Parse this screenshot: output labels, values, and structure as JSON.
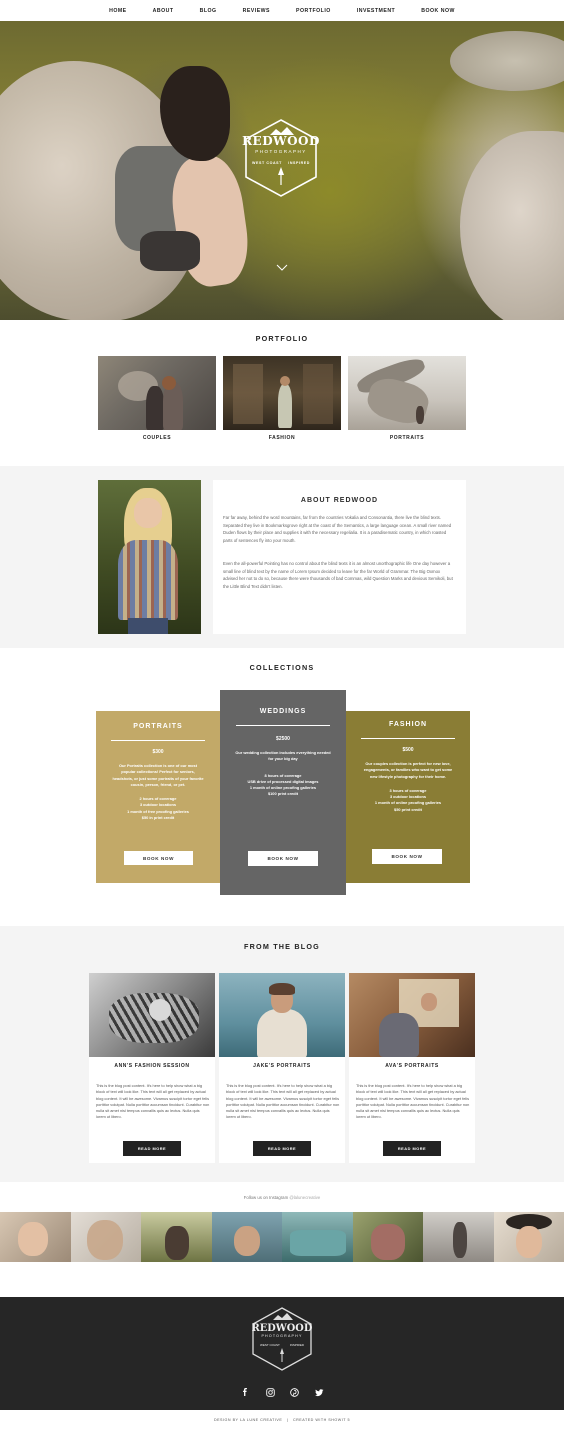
{
  "nav": {
    "items": [
      "HOME",
      "ABOUT",
      "BLOG",
      "REVIEWS",
      "PORTFOLIO",
      "INVESTMENT",
      "BOOK NOW"
    ]
  },
  "hero": {
    "logo_name": "REDWOOD",
    "logo_sub": "PHOTOGRAPHY",
    "logo_left_tag": "WEST COAST",
    "logo_right_tag": "INSPIRED",
    "scroll_icon": "chevron-down-icon"
  },
  "portfolio": {
    "title": "PORTFOLIO",
    "items": [
      {
        "label": "COUPLES"
      },
      {
        "label": "FASHION"
      },
      {
        "label": "PORTRAITS"
      }
    ]
  },
  "about": {
    "title": "ABOUT REDWOOD",
    "para1": "Far far away, behind the word mountains, far from the countries Vokalia and Consonantia, there live the blind texts. Separated they live in Bookmarksgrove right at the coast of the Semantics, a large language ocean. A small river named Duden flows by their place and supplies it with the necessary regelialia. It is a paradisematic country, in which roasted parts of sentences fly into your mouth.",
    "para2": "Even the all-powerful Pointing has no control about the blind texts it is an almost unorthographic life One day however a small line of blind text by the name of Lorem Ipsum decided to leave for the far World of Grammar. The Big Oxmox advised her not to do so, because there were thousands of bad Commas, wild Question Marks and devious Semikoli, but the Little Blind Text didn't listen."
  },
  "collections": {
    "title": "COLLECTIONS",
    "items": [
      {
        "name": "PORTRAITS",
        "price": "$300",
        "desc": "Our Portraits collection is one of our most popular collections! Perfect for seniors, headshots, or just some portraits of your favorite cousin, person, friend, or pet.",
        "features": [
          "2 hours of coverage",
          "3 outdoor locations",
          "1 month of free proofing galleries",
          "$50 in print credit"
        ],
        "button": "BOOK NOW",
        "color": "#c2a968"
      },
      {
        "name": "WEDDINGS",
        "price": "$2500",
        "desc": "Our wedding collection includes everything needed for your big day",
        "features": [
          "8 hours of coverage",
          "USB drive of processed digital images",
          "1 month of online proofing galleries",
          "$100 print credit"
        ],
        "button": "BOOK NOW",
        "color": "#656565"
      },
      {
        "name": "FASHION",
        "price": "$500",
        "desc": "Our couples collection is perfect for new love, engagements, or families who want to get some new lifestyle photography for their home.",
        "features": [
          "3 hours of coverage",
          "3 outdoor locations",
          "1 month of online proofing galleries",
          "$50 print credit"
        ],
        "button": "BOOK NOW",
        "color": "#8a7d35"
      }
    ]
  },
  "blog": {
    "title": "FROM THE BLOG",
    "items": [
      {
        "title": "ANN'S FASHION SESSION",
        "text": "This is the blog post content. It's here to help show what a big block of text will look like. This text will all get replaced by actual blog content. It will be awesome. Vivamus suscipit tortor eget felis porttitor volutpat. Nulla porttitor accumsan tincidunt. Curabitur non nulla sit amet nisl tempus convallis quis ac lectus. Nulla quis lorem ut libero.",
        "button": "READ MORE"
      },
      {
        "title": "JAKE'S PORTRAITS",
        "text": "This is the blog post content. It's here to help show what a big block of text will look like. This text will all get replaced by actual blog content. It will be awesome. Vivamus suscipit tortor eget felis porttitor volutpat. Nulla porttitor accumsan tincidunt. Curabitur non nulla sit amet nisl tempus convallis quis ac lectus. Nulla quis lorem ut libero.",
        "button": "READ MORE"
      },
      {
        "title": "AVA'S PORTRAITS",
        "text": "This is the blog post content. It's here to help show what a big block of text will look like. This text will all get replaced by actual blog content. It will be awesome. Vivamus suscipit tortor eget felis porttitor volutpat. Nulla porttitor accumsan tincidunt. Curabitur non nulla sit amet nisl tempus convallis quis ac lectus. Nulla quis lorem ut libero.",
        "button": "READ MORE"
      }
    ]
  },
  "instagram": {
    "caption": "Follow us on Instagram",
    "handle": "@lalunecreative"
  },
  "footer": {
    "logo_name": "REDWOOD",
    "logo_sub": "PHOTOGRAPHY",
    "logo_left_tag": "WEST COAST",
    "logo_right_tag": "INSPIRED",
    "social_icons": [
      "facebook-icon",
      "instagram-icon",
      "pinterest-icon",
      "twitter-icon"
    ],
    "credit_left": "DESIGN BY LA LUNE CREATIVE",
    "credit_sep": "|",
    "credit_right": "CREATED WITH SHOWIT 5"
  }
}
